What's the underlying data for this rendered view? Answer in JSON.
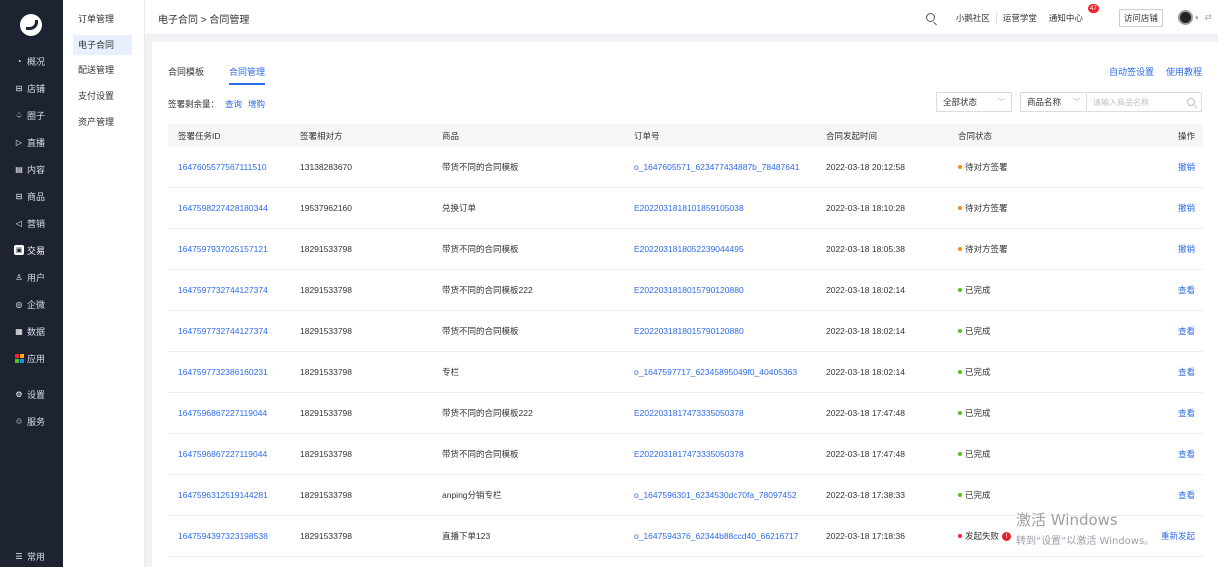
{
  "rail": {
    "items": [
      {
        "icon": "gauge-icon",
        "glyph": "◔",
        "label": "概况"
      },
      {
        "icon": "shop-icon",
        "glyph": "⊟",
        "label": "店铺"
      },
      {
        "icon": "community-icon",
        "glyph": "♤",
        "label": "圈子"
      },
      {
        "icon": "live-icon",
        "glyph": "▷",
        "label": "直播"
      },
      {
        "icon": "content-icon",
        "glyph": "▤",
        "label": "内容"
      },
      {
        "icon": "goods-icon",
        "glyph": "⊟",
        "label": "商品"
      },
      {
        "icon": "marketing-icon",
        "glyph": "◁",
        "label": "营销"
      },
      {
        "icon": "trade-icon",
        "glyph": "▣",
        "label": "交易"
      },
      {
        "icon": "user-icon",
        "glyph": "♙",
        "label": "用户"
      },
      {
        "icon": "wechat-work-icon",
        "glyph": "◎",
        "label": "企微"
      },
      {
        "icon": "data-icon",
        "glyph": "▦",
        "label": "数据"
      },
      {
        "icon": "apps-icon",
        "glyph": "",
        "label": "应用"
      },
      {
        "icon": "settings-icon",
        "glyph": "⚙",
        "label": "设置"
      },
      {
        "icon": "service-icon",
        "glyph": "♲",
        "label": "服务"
      },
      {
        "icon": "menu-icon",
        "glyph": "☰",
        "label": "常用"
      }
    ]
  },
  "subnav": {
    "items": [
      "订单管理",
      "电子合同",
      "配送管理",
      "支付设置",
      "资产管理"
    ]
  },
  "header": {
    "breadcrumb": "电子合同 > 合同管理",
    "links": [
      "小鹅社区",
      "运营学堂"
    ],
    "notification_label": "通知中心",
    "notification_count": "47",
    "visit_store": "访问店铺"
  },
  "tabs": [
    "合同模板",
    "合同管理"
  ],
  "actions": {
    "auto_sign": "自动签设置",
    "tutorial": "使用教程"
  },
  "quota": {
    "label": "签署剩余量：",
    "query": "查询",
    "buy": "增购"
  },
  "filters": {
    "status_value": "全部状态",
    "field_value": "商品名称",
    "search_placeholder": "请输入商品名称"
  },
  "table": {
    "headers": [
      "签署任务ID",
      "签署相对方",
      "商品",
      "订单号",
      "合同发起时间",
      "合同状态",
      "操作"
    ],
    "rows": [
      {
        "id": "1647605577567111510",
        "party": "13138283670",
        "goods": "带货不同的合同模板",
        "order": "o_1647605571_623477434887b_78487641",
        "time": "2022-03-18 20:12:58",
        "status": "待对方签署",
        "status_color": "#fa8c16",
        "action": "撤销"
      },
      {
        "id": "1647598227428180344",
        "party": "19537962160",
        "goods": "兑换订单",
        "order": "E20220318181018591050​38",
        "time": "2022-03-18 18:10:28",
        "status": "待对方签署",
        "status_color": "#fa8c16",
        "action": "撤销"
      },
      {
        "id": "1647597937025157121",
        "party": "18291533798",
        "goods": "带货不同的合同模板",
        "order": "E20220318180522390444​95",
        "time": "2022-03-18 18:05:38",
        "status": "待对方签署",
        "status_color": "#fa8c16",
        "action": "撤销"
      },
      {
        "id": "1647597732744127374",
        "party": "18291533798",
        "goods": "带货不同的合同模板222",
        "order": "E202203181801579012088​0",
        "time": "2022-03-18 18:02:14",
        "status": "已完成",
        "status_color": "#52c41a",
        "action": "查看"
      },
      {
        "id": "1647597732744127374",
        "party": "18291533798",
        "goods": "带货不同的合同模板",
        "order": "E202203181801579012088​0",
        "time": "2022-03-18 18:02:14",
        "status": "已完成",
        "status_color": "#52c41a",
        "action": "查看"
      },
      {
        "id": "1647597732386160231",
        "party": "18291533798",
        "goods": "专栏",
        "order": "o_1647597717_62345895049f0_40405363",
        "time": "2022-03-18 18:02:14",
        "status": "已完成",
        "status_color": "#52c41a",
        "action": "查看"
      },
      {
        "id": "1647596867227119044",
        "party": "18291533798",
        "goods": "带货不同的合同模板222",
        "order": "E202203181747333505037​8",
        "time": "2022-03-18 17:47:48",
        "status": "已完成",
        "status_color": "#52c41a",
        "action": "查看"
      },
      {
        "id": "1647596867227119044",
        "party": "18291533798",
        "goods": "带货不同的合同模板",
        "order": "E202203181747333505037​8",
        "time": "2022-03-18 17:47:48",
        "status": "已完成",
        "status_color": "#52c41a",
        "action": "查看"
      },
      {
        "id": "1647596312519144281",
        "party": "18291533798",
        "goods": "anping分销专栏",
        "order": "o_1647596301_6234530dc70fa_78097452",
        "time": "2022-03-18 17:38:33",
        "status": "已完成",
        "status_color": "#52c41a",
        "action": "查看"
      },
      {
        "id": "1647594397323198538",
        "party": "18291533798",
        "goods": "直播下单123",
        "order": "o_1647594376_62344b88ccd40_66216717",
        "time": "2022-03-18 17:18:36",
        "status": "发起失败",
        "status_color": "#f5222d",
        "action": "重新发起"
      }
    ]
  },
  "watermark": {
    "title": "激活 Windows",
    "subtitle": "转到“设置”以激活 Windows。"
  }
}
